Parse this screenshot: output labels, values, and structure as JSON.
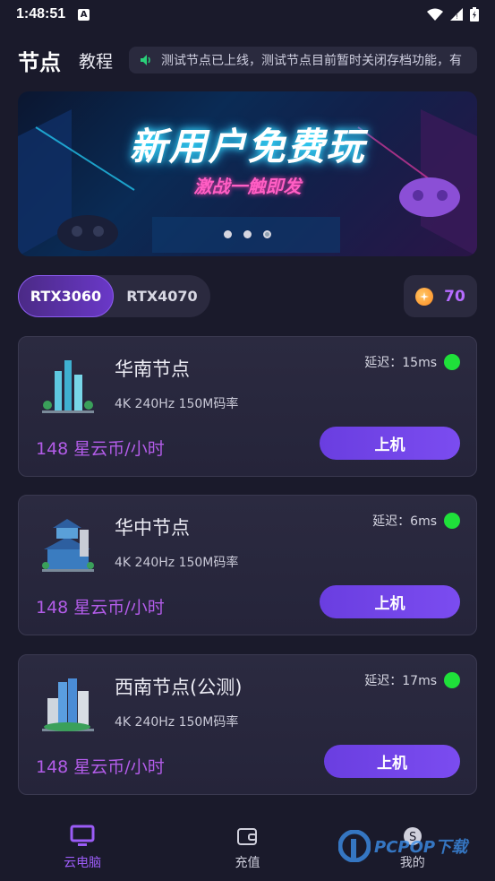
{
  "status": {
    "time": "1:48:51",
    "notif": "A"
  },
  "header": {
    "title": "节点",
    "tutorial": "教程",
    "notice": "测试节点已上线，测试节点目前暂时关闭存档功能，有"
  },
  "banner": {
    "title": "新用户免费玩",
    "subtitle": "激战一触即发",
    "slides": 3,
    "active_slide": 2
  },
  "gpu_tabs": [
    {
      "label": "RTX3060",
      "active": true
    },
    {
      "label": "RTX4070",
      "active": false
    }
  ],
  "coins": {
    "value": "70"
  },
  "nodes": [
    {
      "name": "华南节点",
      "spec": "4K 240Hz 150M码率",
      "latency": "延迟：15ms",
      "price": "148 星云币/小时",
      "button": "上机"
    },
    {
      "name": "华中节点",
      "spec": "4K 240Hz 150M码率",
      "latency": "延迟：6ms",
      "price": "148 星云币/小时",
      "button": "上机"
    },
    {
      "name": "西南节点(公测)",
      "spec": "4K 240Hz 150M码率",
      "latency": "延迟：17ms",
      "price": "148 星云币/小时",
      "button": "上机"
    }
  ],
  "tabbar": [
    {
      "label": "云电脑",
      "icon": "monitor-icon",
      "active": true
    },
    {
      "label": "充值",
      "icon": "wallet-icon",
      "active": false
    },
    {
      "label": "我的",
      "icon": "profile-icon",
      "active": false
    }
  ],
  "watermark": {
    "text": "PCPOP下载"
  },
  "colors": {
    "accent": "#7b4cf0",
    "price": "#b25ce8",
    "latency_ok": "#1fe03a",
    "background": "#1a1a2b"
  }
}
